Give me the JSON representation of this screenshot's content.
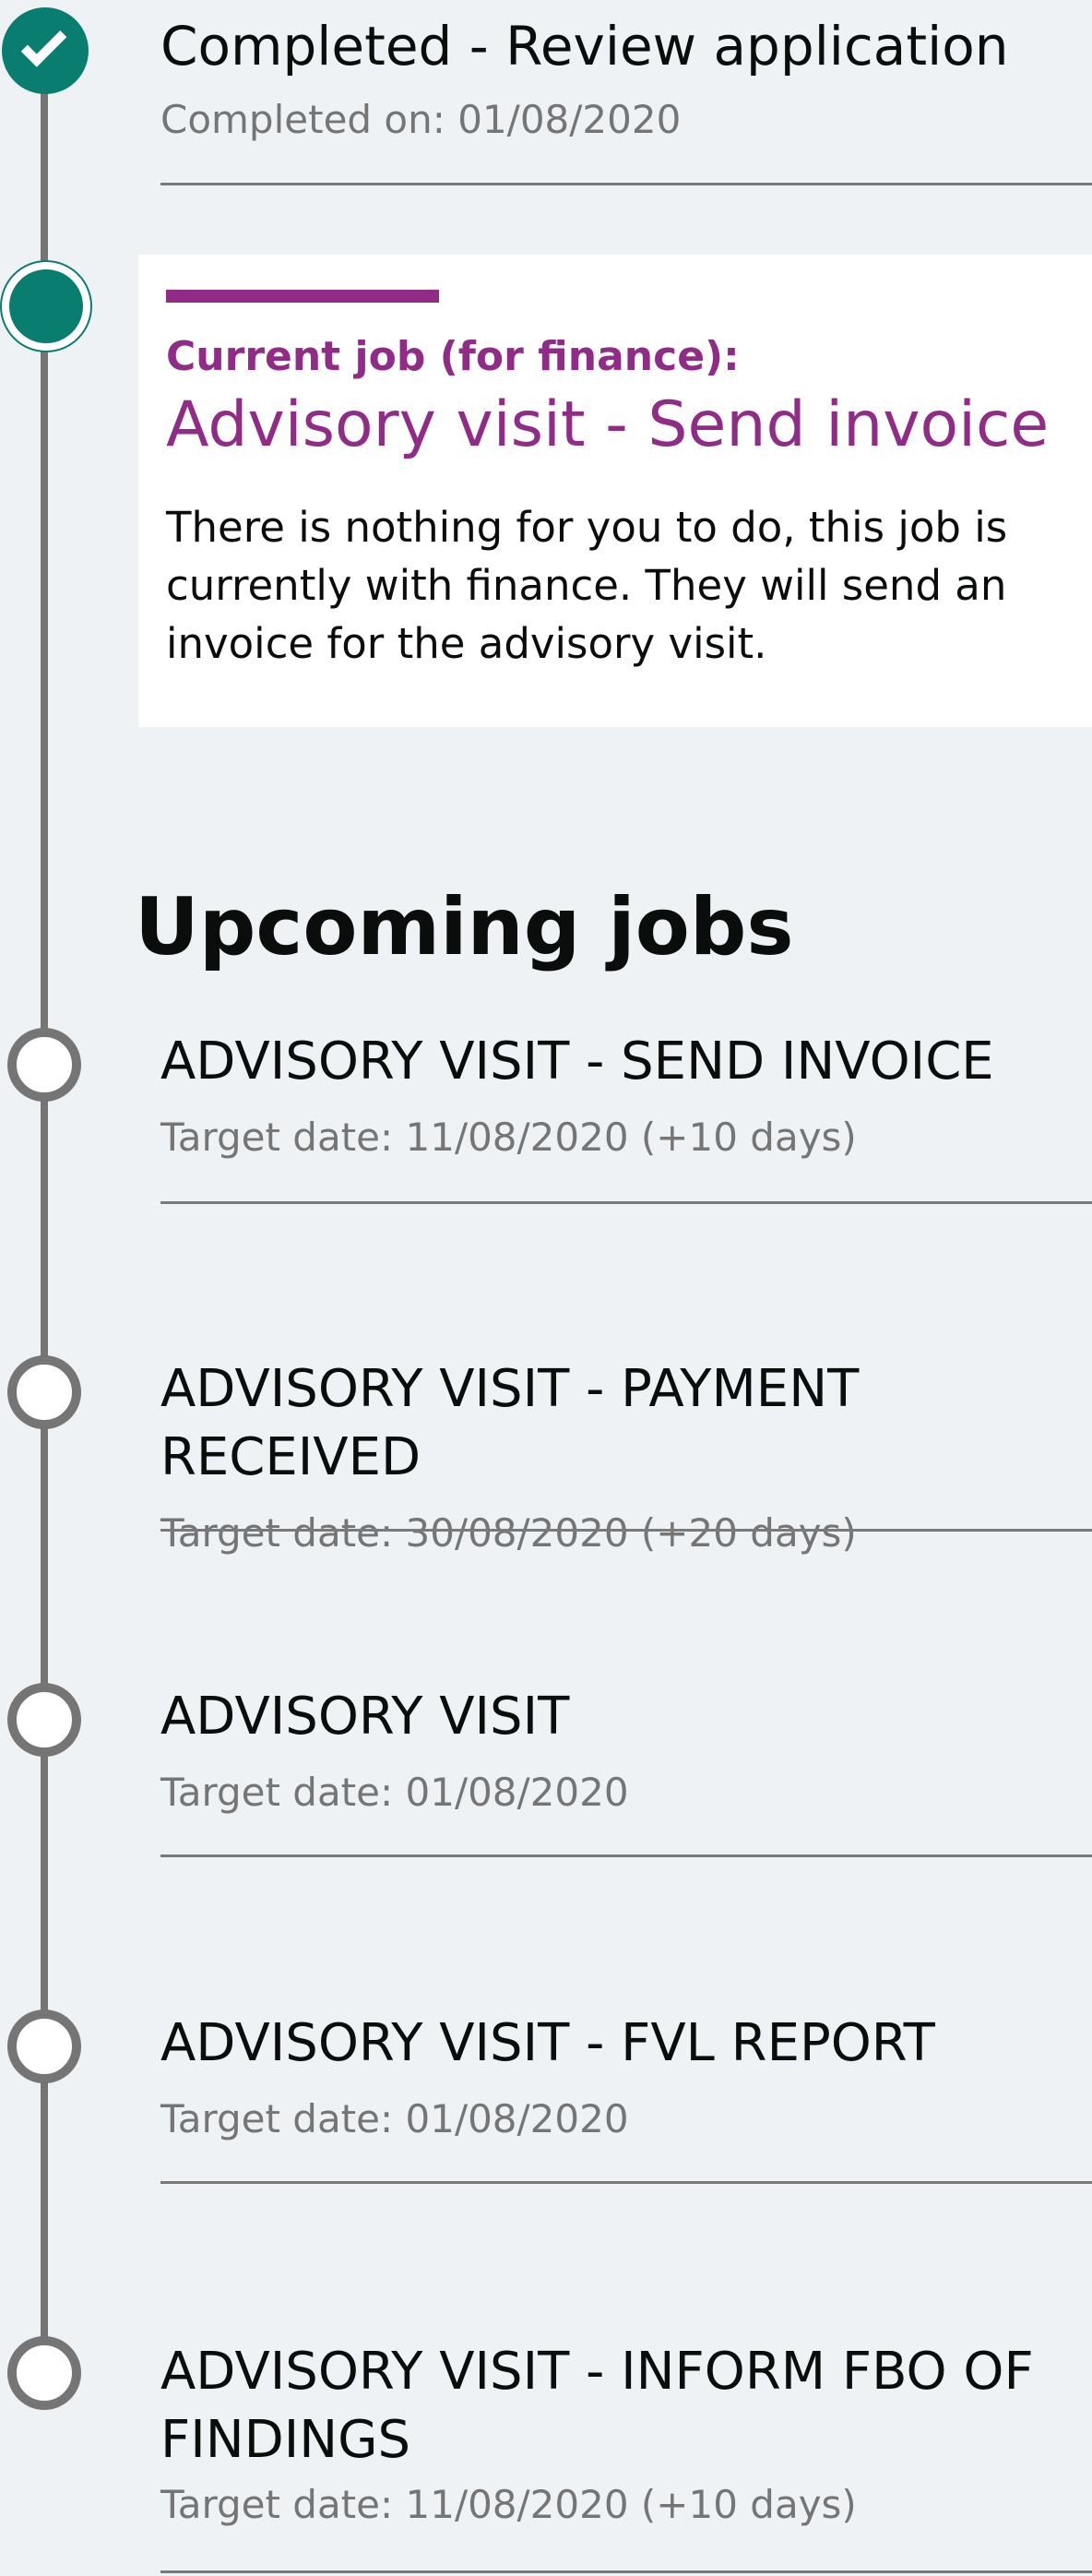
{
  "completed": {
    "title": "Completed - Review application",
    "date": "Completed on: 01/08/2020"
  },
  "current": {
    "kicker": "Current job (for finance):",
    "title": "Advisory visit - Send invoice",
    "description": "There is nothing for you to do, this job is currently with finance. They will send an invoice for the advisory visit."
  },
  "upcoming": {
    "heading": "Upcoming jobs",
    "jobs": [
      {
        "title": "ADVISORY VISIT - SEND INVOICE",
        "date": "Target date: 11/08/2020 (+10 days)"
      },
      {
        "title": "ADVISORY VISIT - PAYMENT RECEIVED",
        "date": "Target date: 30/08/2020 (+20 days)"
      },
      {
        "title": "ADVISORY VISIT",
        "date": "Target date: 01/08/2020"
      },
      {
        "title": "ADVISORY VISIT - FVL REPORT",
        "date": "Target date: 01/08/2020"
      },
      {
        "title": "ADVISORY VISIT - INFORM FBO OF FINDINGS",
        "date": "Target date: 11/08/2020 (+10 days)"
      }
    ]
  },
  "colors": {
    "completed": "#0a7d71",
    "current": "#912b88",
    "upcoming": "#757575"
  },
  "icons": {
    "completed_marker": "check-icon",
    "current_marker": "current-step-icon",
    "upcoming_marker": "circle-icon"
  }
}
